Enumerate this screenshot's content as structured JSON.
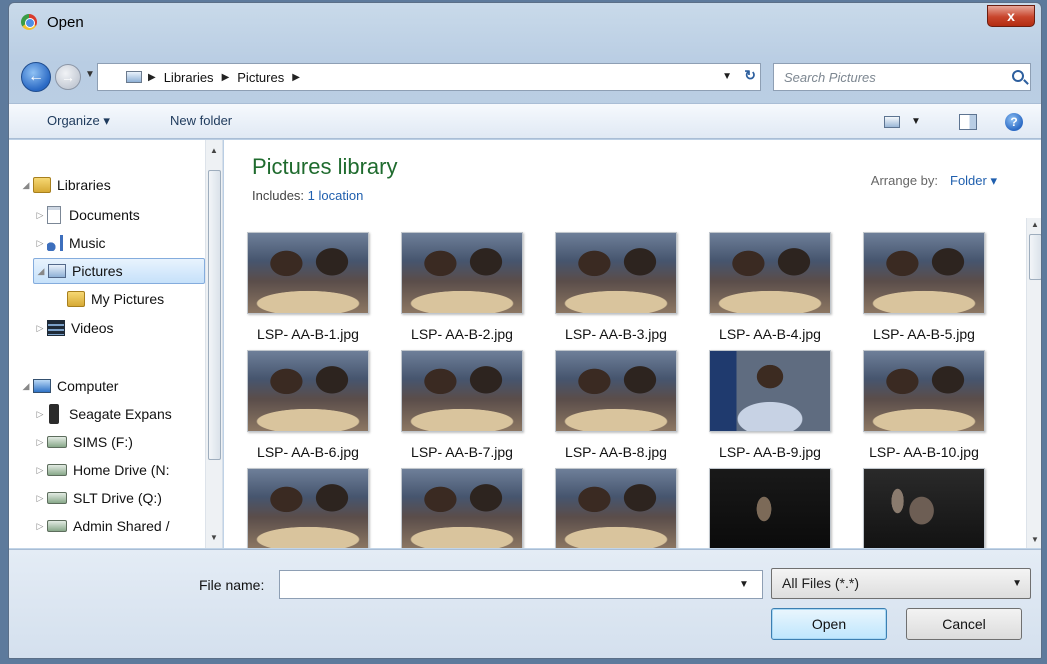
{
  "window": {
    "title": "Open",
    "close_label": "x"
  },
  "nav": {
    "breadcrumbs": [
      "Libraries",
      "Pictures"
    ],
    "search_placeholder": "Search Pictures"
  },
  "toolbar": {
    "organize_label": "Organize",
    "new_folder_label": "New folder"
  },
  "sidebar": {
    "items": [
      {
        "label": "Libraries",
        "icon": "library-icon",
        "expander": "open"
      },
      {
        "label": "Documents",
        "icon": "documents-icon",
        "expander": "closed"
      },
      {
        "label": "Music",
        "icon": "music-icon",
        "expander": "closed"
      },
      {
        "label": "Pictures",
        "icon": "pictures-icon",
        "expander": "open",
        "selected": true
      },
      {
        "label": "My Pictures",
        "icon": "folder-icon"
      },
      {
        "label": "Videos",
        "icon": "videos-icon",
        "expander": "closed"
      },
      {
        "label": "Computer",
        "icon": "computer-icon",
        "expander": "open"
      },
      {
        "label": "Seagate Expans",
        "icon": "external-drive-icon",
        "expander": "closed"
      },
      {
        "label": "SIMS (F:)",
        "icon": "network-drive-icon",
        "expander": "closed"
      },
      {
        "label": "Home Drive (N:",
        "icon": "network-drive-icon",
        "expander": "closed"
      },
      {
        "label": "SLT Drive (Q:)",
        "icon": "network-drive-icon",
        "expander": "closed"
      },
      {
        "label": "Admin Shared /",
        "icon": "network-drive-icon",
        "expander": "closed"
      }
    ]
  },
  "library": {
    "title": "Pictures library",
    "includes_label": "Includes:",
    "includes_link": "1 location",
    "arrange_label": "Arrange by:",
    "arrange_value": "Folder"
  },
  "files": [
    {
      "name": "LSP- AA-B-1.jpg",
      "style": "group"
    },
    {
      "name": "LSP- AA-B-2.jpg",
      "style": "group"
    },
    {
      "name": "LSP- AA-B-3.jpg",
      "style": "group"
    },
    {
      "name": "LSP- AA-B-4.jpg",
      "style": "group"
    },
    {
      "name": "LSP- AA-B-5.jpg",
      "style": "group"
    },
    {
      "name": "LSP- AA-B-6.jpg",
      "style": "group"
    },
    {
      "name": "LSP- AA-B-7.jpg",
      "style": "group"
    },
    {
      "name": "LSP- AA-B-8.jpg",
      "style": "group"
    },
    {
      "name": "LSP- AA-B-9.jpg",
      "style": "portrait"
    },
    {
      "name": "LSP- AA-B-10.jpg",
      "style": "group"
    },
    {
      "name": "",
      "style": "group"
    },
    {
      "name": "",
      "style": "group"
    },
    {
      "name": "",
      "style": "group"
    },
    {
      "name": "",
      "style": "dark"
    },
    {
      "name": "",
      "style": "dark2"
    }
  ],
  "footer": {
    "file_name_label": "File name:",
    "file_name_value": "",
    "file_type": "All Files (*.*)",
    "open_label": "Open",
    "cancel_label": "Cancel"
  }
}
